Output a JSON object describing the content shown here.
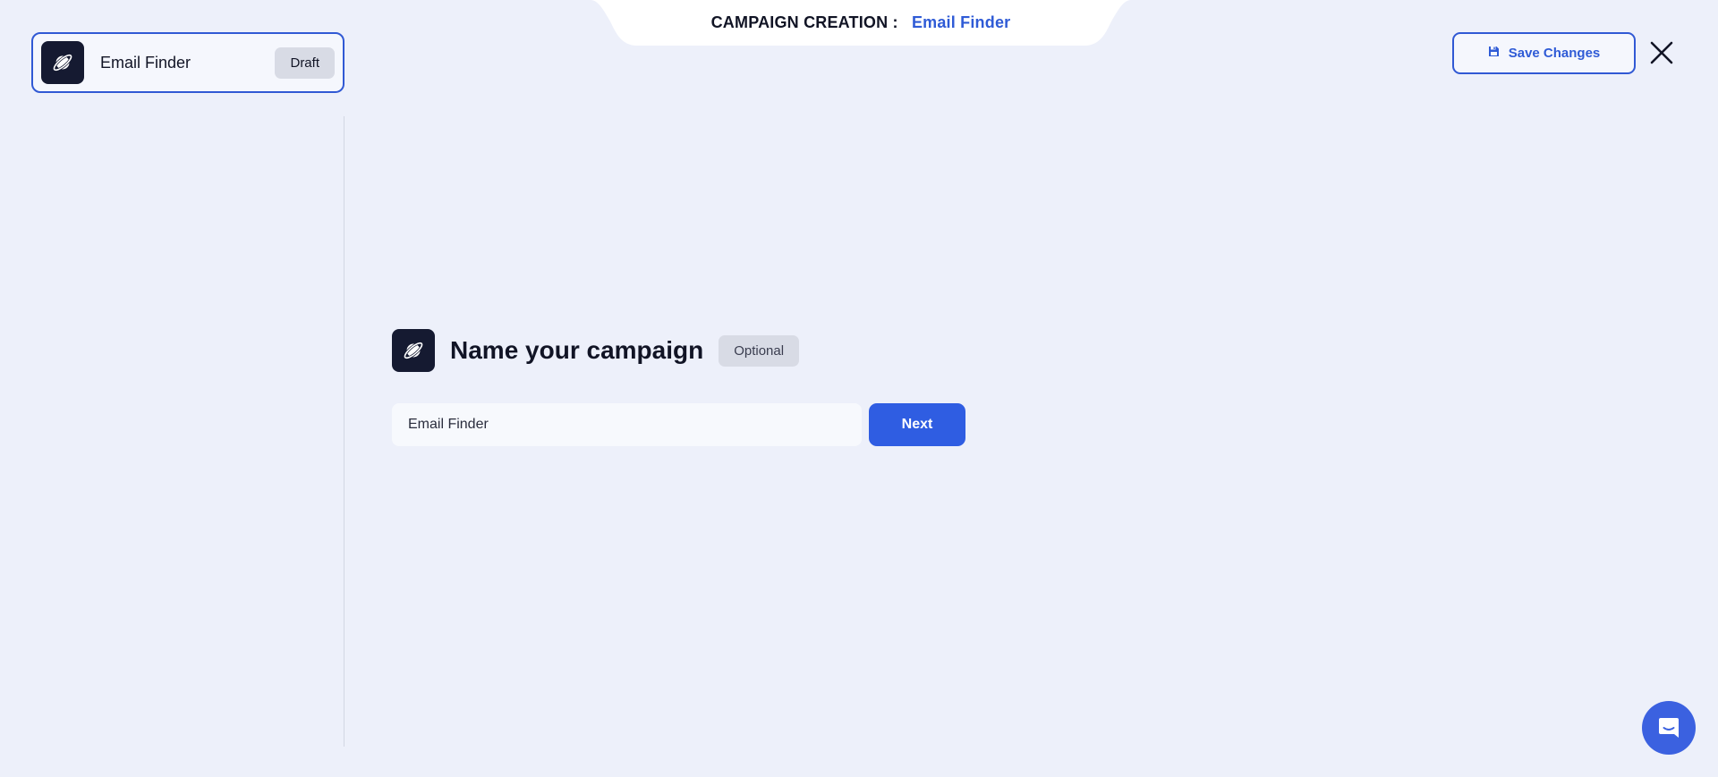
{
  "header": {
    "label": "CAMPAIGN CREATION :",
    "value": "Email Finder"
  },
  "campaign_card": {
    "icon": "planet-icon",
    "name": "Email Finder",
    "status": "Draft"
  },
  "toolbar": {
    "save_icon": "floppy-disk-icon",
    "save_label": "Save Changes",
    "close_icon": "close-icon"
  },
  "main": {
    "icon": "planet-icon",
    "title": "Name your campaign",
    "optional_label": "Optional",
    "campaign_name_value": "Email Finder",
    "next_label": "Next"
  },
  "chat": {
    "icon": "chat-icon"
  },
  "colors": {
    "accent": "#2f5de2",
    "background": "#edf0fa",
    "icon_bg": "#151a31"
  }
}
